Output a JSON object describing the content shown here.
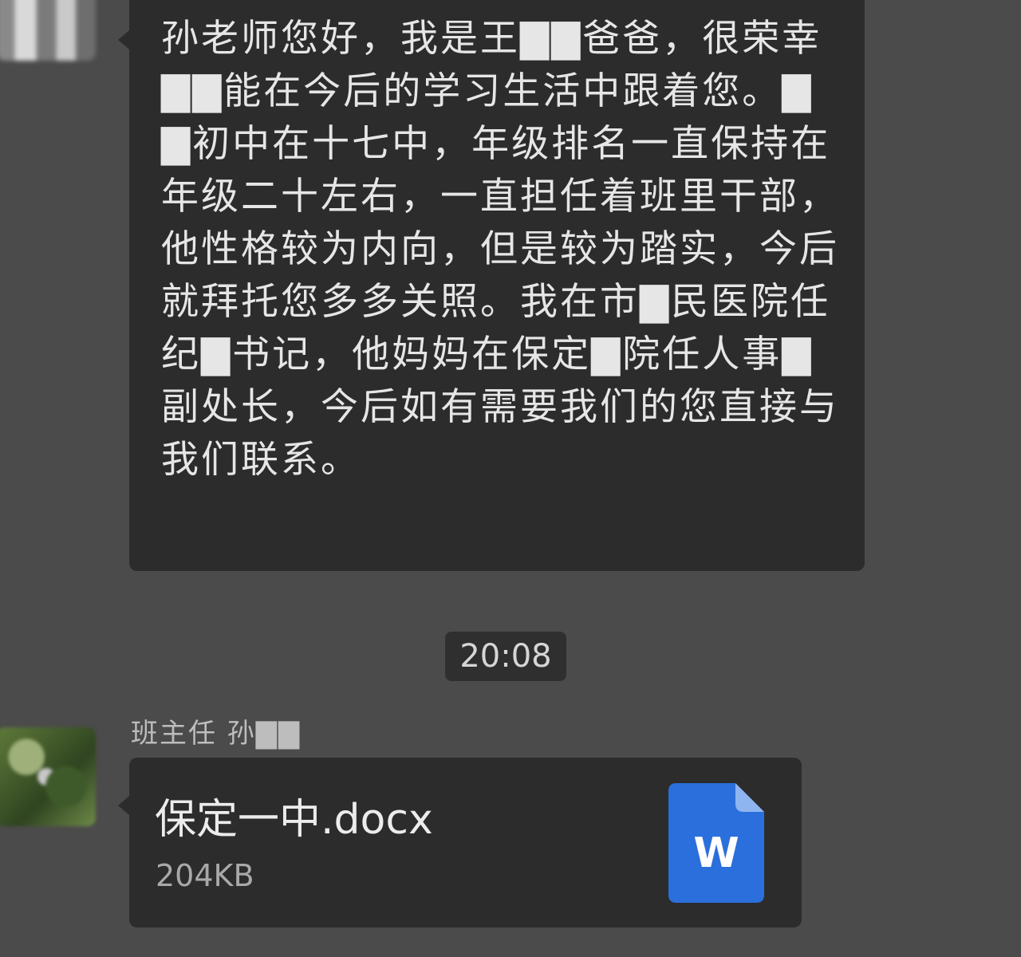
{
  "conversation": {
    "parent_message": "孙老师您好，我是王▇▇爸爸，很荣幸▇▇能在今后的学习生活中跟着您。▇▇初中在十七中，年级排名一直保持在年级二十左右，一直担任着班里干部，他性格较为内向，但是较为踏实，今后就拜托您多多关照。我在市▇民医院任纪▇书记，他妈妈在保定▇院任人事▇副处长，今后如有需要我们的您直接与我们联系。",
    "timestamp": "20:08",
    "teacher_name": "班主任 孙▇▇",
    "file": {
      "name": "保定一中.docx",
      "size": "204KB",
      "icon": "word-document-icon",
      "icon_letter": "W"
    }
  },
  "colors": {
    "background": "#4b4b4b",
    "bubble": "#2c2c2c",
    "word_blue": "#2b6fdc"
  }
}
